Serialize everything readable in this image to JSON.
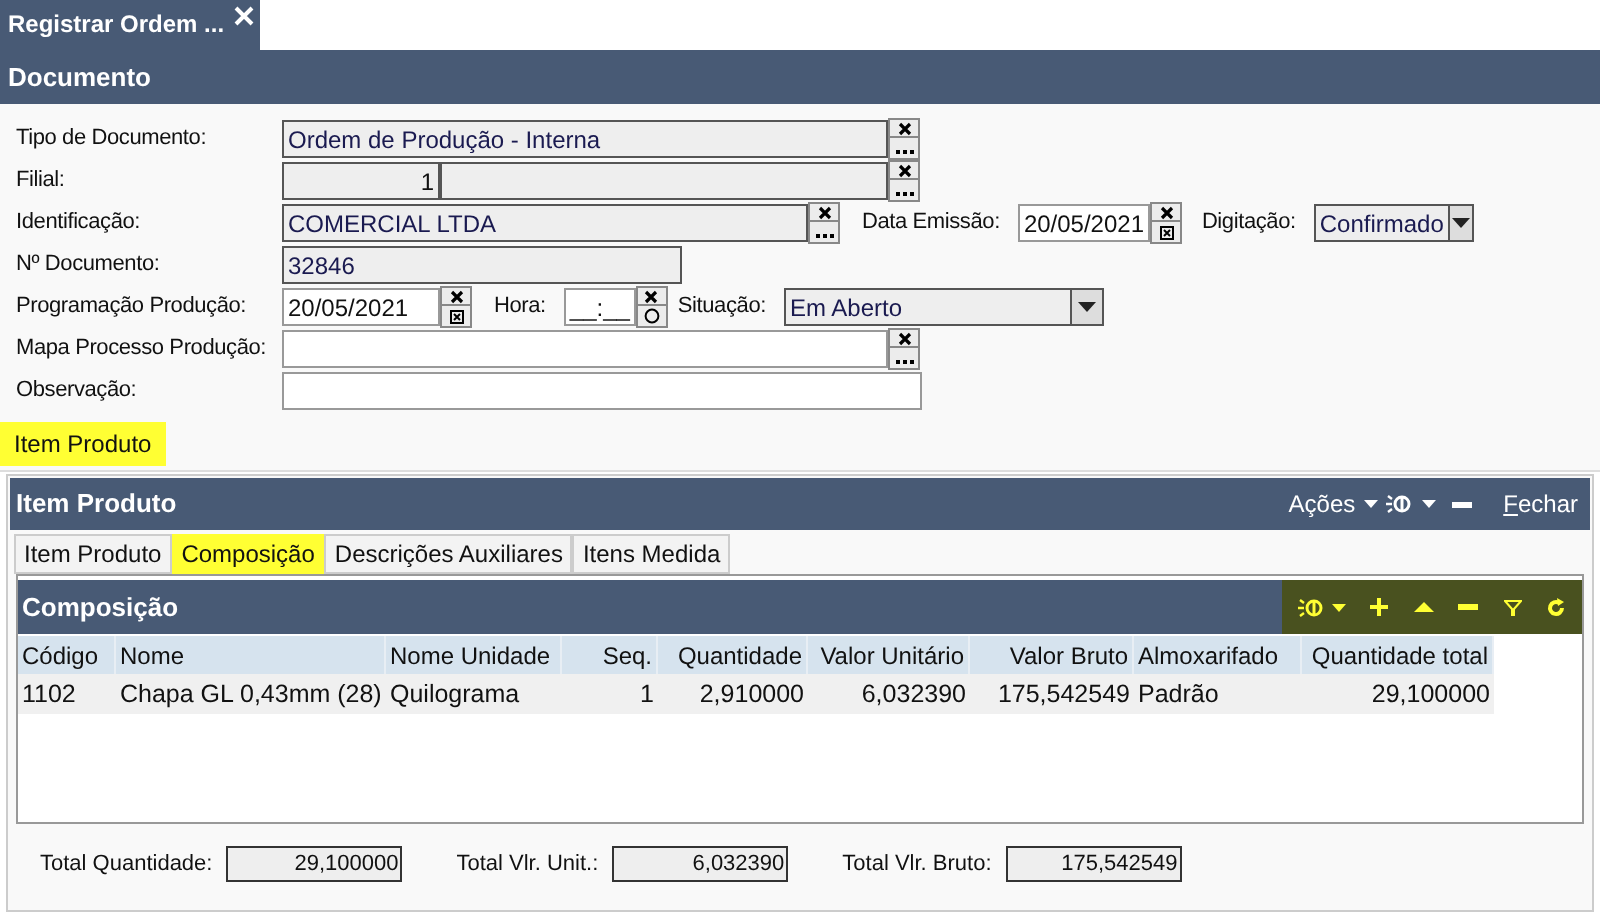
{
  "window_tab": {
    "title": "Registrar Ordem ...",
    "selected": true
  },
  "document": {
    "title": "Documento",
    "rows": [
      {
        "items": [
          {
            "kind": "label",
            "text": "Tipo de Documento:"
          },
          {
            "kind": "lookup",
            "value": "Ordem de Produção - Interna",
            "readonly": true
          }
        ]
      },
      {
        "items": [
          {
            "kind": "label",
            "text": "Filial:"
          },
          {
            "kind": "number",
            "value": "1",
            "readonly": true
          },
          {
            "kind": "lookup",
            "value": "",
            "readonly": true
          }
        ]
      },
      {
        "items": [
          {
            "kind": "label",
            "text": "Identificação:"
          },
          {
            "kind": "lookup",
            "value": "COMERCIAL LTDA",
            "readonly": true
          },
          {
            "kind": "label",
            "text": "Data Emissão:"
          },
          {
            "kind": "date",
            "value": "20/05/2021",
            "readonly": false
          },
          {
            "kind": "label",
            "text": "Digitação:"
          },
          {
            "kind": "select",
            "value": "Confirmado",
            "readonly": true
          }
        ]
      },
      {
        "items": [
          {
            "kind": "label",
            "text": "Nº Documento:"
          },
          {
            "kind": "text",
            "value": "32846",
            "readonly": true
          }
        ]
      },
      {
        "items": [
          {
            "kind": "label",
            "text": "Programação Produção:"
          },
          {
            "kind": "date",
            "value": "20/05/2021",
            "readonly": false
          },
          {
            "kind": "label",
            "text": "Hora:"
          },
          {
            "kind": "time",
            "value": "__:__",
            "readonly": false
          },
          {
            "kind": "label",
            "text": "Situação:"
          },
          {
            "kind": "select",
            "value": "Em Aberto",
            "readonly": true
          }
        ]
      },
      {
        "items": [
          {
            "kind": "label",
            "text": "Mapa Processo Produção:"
          },
          {
            "kind": "lookup",
            "value": "",
            "readonly": false
          }
        ]
      },
      {
        "items": [
          {
            "kind": "label",
            "text": "Observação:"
          },
          {
            "kind": "text",
            "value": "",
            "readonly": false
          }
        ]
      }
    ]
  },
  "section_tabs": [
    {
      "label": "Item Produto",
      "selected": true
    }
  ],
  "item_panel": {
    "title": "Item Produto",
    "actions_label": "Ações",
    "close_label": "Fechar",
    "tabs": [
      {
        "label": "Item Produto",
        "selected": false
      },
      {
        "label": "Composição",
        "selected": true
      },
      {
        "label": "Descrições Auxiliares",
        "selected": false
      },
      {
        "label": "Itens Medida",
        "selected": false
      }
    ],
    "grid": {
      "title": "Composição",
      "columns": [
        "Código",
        "Nome",
        "Nome Unidade",
        "Seq.",
        "Quantidade",
        "Valor Unitário",
        "Valor Bruto",
        "Almoxarifado",
        "Quantidade total"
      ],
      "rows": [
        [
          "1102",
          "Chapa GL 0,43mm (28)",
          "Quilograma",
          "1",
          "2,910000",
          "6,032390",
          "175,542549",
          "Padrão",
          "29,100000"
        ]
      ]
    },
    "totals": [
      {
        "label": "Total Quantidade:",
        "value": "29,100000"
      },
      {
        "label": "Total Vlr. Unit.:",
        "value": "6,032390"
      },
      {
        "label": "Total Vlr. Bruto:",
        "value": "175,542549"
      }
    ]
  }
}
